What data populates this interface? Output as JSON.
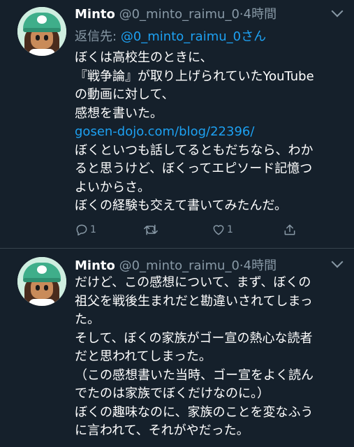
{
  "tweets": [
    {
      "name": "Minto",
      "handle": "@0_minto_raimu_0",
      "dot": "·",
      "time": "4時間",
      "reply_label": "返信先:",
      "reply_handle": "@0_minto_raimu_0さん",
      "lines": [
        "ぼくは高校生のときに、",
        "『戦争論』が取り上げられていたYouTube",
        "の動画に対して、",
        "感想を書いた。",
        "gosen-dojo.com/blog/22396/",
        "ぼくといつも話してるともだちなら、わか",
        "ると思うけど、ぼくってエピソード記憶つ",
        "よいからさ。",
        "ぼくの経験も交えて書いてみたんだ。"
      ],
      "link_line_index": 4,
      "reply_count": "1",
      "like_count": "1"
    },
    {
      "name": "Minto",
      "handle": "@0_minto_raimu_0",
      "dot": "·",
      "time": "4時間",
      "lines": [
        "だけど、この感想について、まず、ぼくの",
        "祖父を戦後生まれだと勘違いされてしまっ",
        "た。",
        "そして、ぼくの家族がゴー宣の熱心な読者",
        "だと思われてしまった。",
        "（この感想書いた当時、ゴー宣をよく読ん",
        "でたのは家族でぼくだけなのに。）",
        "ぼくの趣味なのに、家族のことを変なふう",
        "に言われて、それがやだった。"
      ]
    }
  ],
  "icons": {
    "reply": "reply-icon",
    "retweet": "retweet-icon",
    "like": "heart-icon",
    "share": "share-icon",
    "menu": "chevron-down-icon"
  },
  "colors": {
    "background": "#15202b",
    "text": "#ffffff",
    "muted": "#8899a6",
    "link": "#1da1f2",
    "divider": "#38444d"
  }
}
